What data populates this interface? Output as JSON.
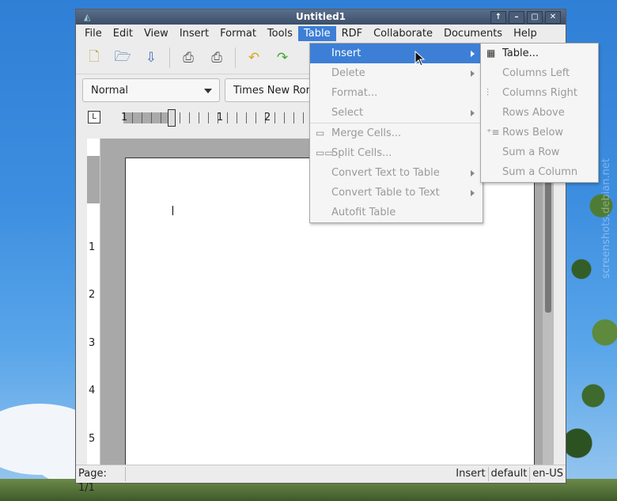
{
  "window": {
    "title": "Untitled1",
    "controls": [
      "↑",
      "–",
      "▢",
      "✕"
    ]
  },
  "menubar": {
    "items": [
      "File",
      "Edit",
      "View",
      "Insert",
      "Format",
      "Tools",
      "Table",
      "RDF",
      "Collaborate",
      "Documents",
      "Help"
    ],
    "active_index": 6
  },
  "toolbar": {
    "icons": [
      "new-document-icon",
      "open-folder-icon",
      "save-icon",
      "print-icon",
      "print-preview-icon",
      "undo-icon",
      "redo-icon"
    ]
  },
  "formatbar": {
    "style_value": "Normal",
    "font_value": "Times New Roman"
  },
  "ruler": {
    "h_numbers": [
      "1",
      "1",
      "2"
    ],
    "v_numbers": [
      "1",
      "2",
      "3",
      "4",
      "5"
    ]
  },
  "status": {
    "page": "Page: 1/1",
    "mode": "Insert",
    "lang_default": "default",
    "locale": "en-US"
  },
  "table_menu": {
    "items": [
      {
        "label": "Insert",
        "disabled": false,
        "submenu": true,
        "highlight": true,
        "icon": ""
      },
      {
        "label": "Delete",
        "disabled": true,
        "submenu": true,
        "highlight": false,
        "icon": ""
      },
      {
        "label": "Format...",
        "disabled": true,
        "submenu": false,
        "highlight": false,
        "icon": ""
      },
      {
        "label": "Select",
        "disabled": true,
        "submenu": true,
        "highlight": false,
        "icon": ""
      },
      {
        "label": "Merge Cells...",
        "disabled": true,
        "submenu": false,
        "highlight": false,
        "icon": "merge-cells-icon"
      },
      {
        "label": "Split Cells...",
        "disabled": true,
        "submenu": false,
        "highlight": false,
        "icon": "split-cells-icon"
      },
      {
        "label": "Convert Text to Table",
        "disabled": true,
        "submenu": true,
        "highlight": false,
        "icon": ""
      },
      {
        "label": "Convert Table to Text",
        "disabled": true,
        "submenu": true,
        "highlight": false,
        "icon": ""
      },
      {
        "label": "Autofit Table",
        "disabled": true,
        "submenu": false,
        "highlight": false,
        "icon": ""
      }
    ]
  },
  "insert_submenu": {
    "items": [
      {
        "label": "Table...",
        "disabled": false,
        "icon": "table-grid-icon"
      },
      {
        "label": "Columns Left",
        "disabled": true,
        "icon": ""
      },
      {
        "label": "Columns Right",
        "disabled": true,
        "icon": "column-right-icon"
      },
      {
        "label": "Rows Above",
        "disabled": true,
        "icon": ""
      },
      {
        "label": "Rows Below",
        "disabled": true,
        "icon": "rows-below-icon"
      },
      {
        "label": "Sum a Row",
        "disabled": true,
        "icon": ""
      },
      {
        "label": "Sum a Column",
        "disabled": true,
        "icon": ""
      }
    ]
  },
  "watermark": "screenshots.debian.net",
  "colors": {
    "accent": "#3d7fd6",
    "disabled_text": "#9a9a9a"
  }
}
